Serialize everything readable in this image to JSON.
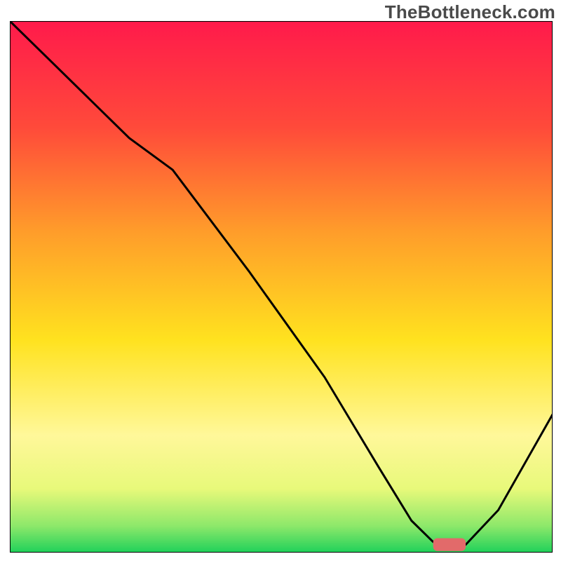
{
  "watermark": "TheBottleneck.com",
  "chart_data": {
    "type": "line",
    "title": "",
    "xlabel": "",
    "ylabel": "",
    "xlim": [
      0,
      100
    ],
    "ylim": [
      0,
      100
    ],
    "grid": false,
    "legend": false,
    "annotations": [],
    "background": {
      "type": "vertical-gradient",
      "stops": [
        {
          "offset": 0.0,
          "color": "#ff1a4b"
        },
        {
          "offset": 0.2,
          "color": "#ff4a3a"
        },
        {
          "offset": 0.4,
          "color": "#ff9e2a"
        },
        {
          "offset": 0.6,
          "color": "#ffe21f"
        },
        {
          "offset": 0.78,
          "color": "#fff89a"
        },
        {
          "offset": 0.88,
          "color": "#e8f97a"
        },
        {
          "offset": 0.95,
          "color": "#8de86a"
        },
        {
          "offset": 1.0,
          "color": "#1fd15a"
        }
      ]
    },
    "series": [
      {
        "name": "bottleneck-curve",
        "color": "#000000",
        "x": [
          0,
          8,
          22,
          30,
          44,
          58,
          68,
          74,
          78,
          82,
          84,
          90,
          100
        ],
        "values": [
          100,
          92,
          78,
          72,
          53,
          33,
          16,
          6,
          2,
          1.5,
          1.5,
          8,
          26
        ]
      }
    ],
    "marker": {
      "name": "optimal-range",
      "color": "#e26a6a",
      "x_start": 78,
      "x_end": 84,
      "y": 1.5,
      "height": 2.4
    }
  }
}
